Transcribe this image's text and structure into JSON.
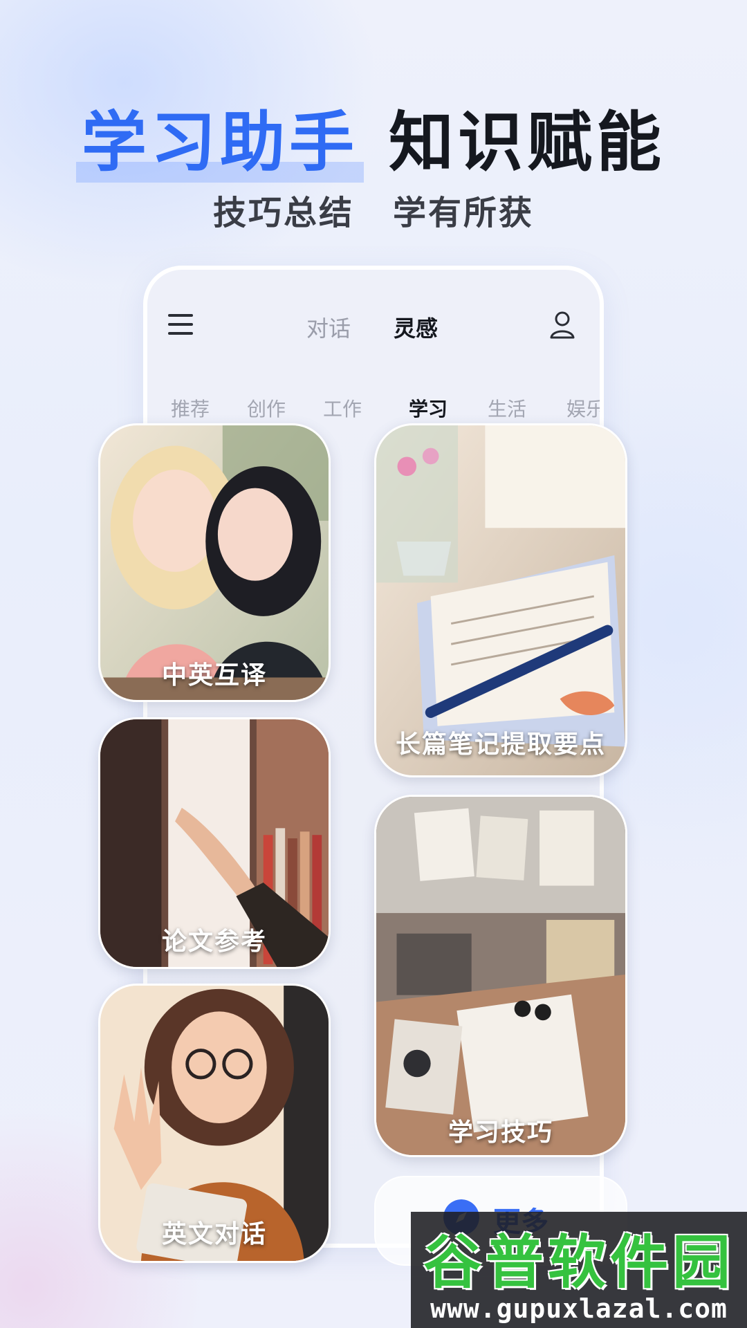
{
  "headline": {
    "blue": "学习助手",
    "dark": "知识赋能"
  },
  "subline": {
    "left": "技巧总结",
    "right": "学有所获"
  },
  "app": {
    "top_tabs": [
      "对话",
      "灵感"
    ],
    "active_top_tab": "灵感",
    "categories": [
      "推荐",
      "创作",
      "工作",
      "学习",
      "生活",
      "娱乐"
    ],
    "active_category": "学习"
  },
  "cards": [
    {
      "label": "中英互译"
    },
    {
      "label": "论文参考"
    },
    {
      "label": "英文对话"
    },
    {
      "label": "长篇笔记提取要点"
    },
    {
      "label": "学习技巧"
    }
  ],
  "more": {
    "label": "更多"
  },
  "watermark": {
    "title": "谷普软件园",
    "url": "www.gupuxlazal.com"
  },
  "colors": {
    "accent": "#2f6bf4",
    "text_dark": "#15181f",
    "tab_inactive": "#9a9daa"
  },
  "icons": [
    "menu-icon",
    "user-icon",
    "compass-icon"
  ]
}
